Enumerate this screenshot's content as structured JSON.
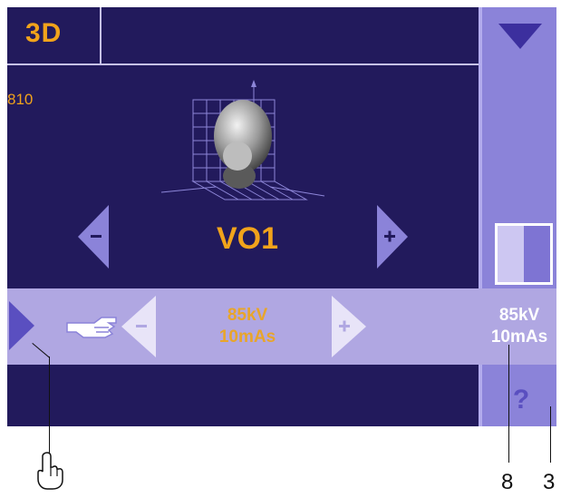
{
  "main": {
    "tab_label": "3D",
    "code": "810",
    "program": "VO1"
  },
  "strip": {
    "kv": "85kV",
    "mas": "10mAs"
  },
  "actual": {
    "kv": "85kV",
    "mas": "10mAs"
  },
  "help_label": "?",
  "callouts": {
    "a": "8",
    "b": "3"
  },
  "colors": {
    "panel": "#221a5c",
    "accent": "#f1a31b",
    "strip": "#b0a7e2",
    "side": "#8b83d9"
  },
  "icons": [
    "head-3d-grid-icon",
    "minus-left-arrow-icon",
    "plus-right-arrow-icon",
    "dropdown-triangle-icon",
    "split-view-icon",
    "pointing-hand-icon",
    "play-triangle-icon",
    "hand-cursor-icon",
    "help-icon"
  ]
}
